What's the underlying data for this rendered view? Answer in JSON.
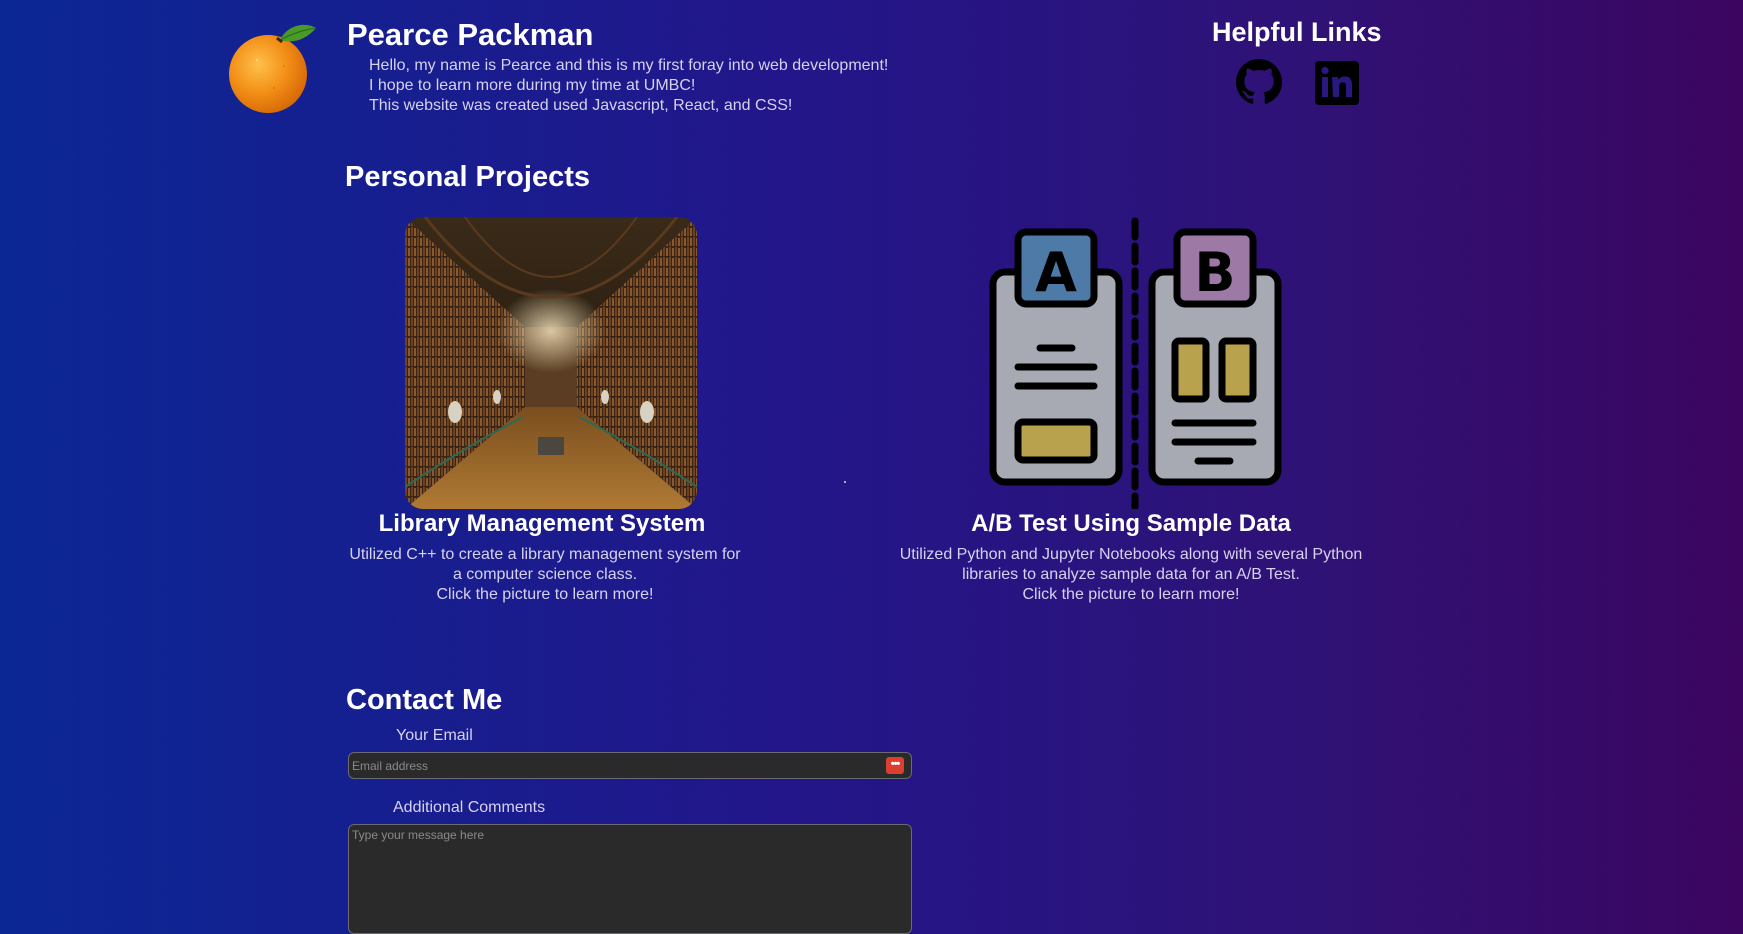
{
  "header": {
    "name": "Pearce Packman",
    "intro_lines": [
      "Hello, my name is Pearce and this is my first foray into web development!",
      "I hope to learn more during my time at UMBC!",
      "This website was created used Javascript, React, and CSS!"
    ],
    "logo_icon": "orange-icon"
  },
  "helpful_links": {
    "title": "Helpful Links",
    "items": [
      {
        "icon": "github-icon"
      },
      {
        "icon": "linkedin-icon"
      }
    ]
  },
  "projects": {
    "title": "Personal Projects",
    "items": [
      {
        "title": "Library Management System",
        "description_lines": [
          "Utilized C++ to create a library management system for",
          "a computer science class.",
          "Click the picture to learn more!"
        ],
        "image": "library-hall-image"
      },
      {
        "title": "A/B Test Using Sample Data",
        "description_lines": [
          "Utilized Python and Jupyter Notebooks along with several Python",
          "libraries to analyze sample data for an A/B Test.",
          "Click the picture to learn more!"
        ],
        "image": "ab-test-icon",
        "panel_letters": [
          "A",
          "B"
        ]
      }
    ]
  },
  "contact": {
    "title": "Contact Me",
    "email_label": "Your Email",
    "email_placeholder": "Email address",
    "comments_label": "Additional Comments",
    "comments_placeholder": "Type your message here"
  },
  "colors": {
    "background_left": "#0b2794",
    "background_right": "#3b0560",
    "input_bg": "#2a2a2a",
    "panel_a": "#4d7aa6",
    "panel_b": "#9c7aa5",
    "panel_accent": "#b8a24e",
    "panel_body": "#a8aab3",
    "orange": "#f39018"
  }
}
